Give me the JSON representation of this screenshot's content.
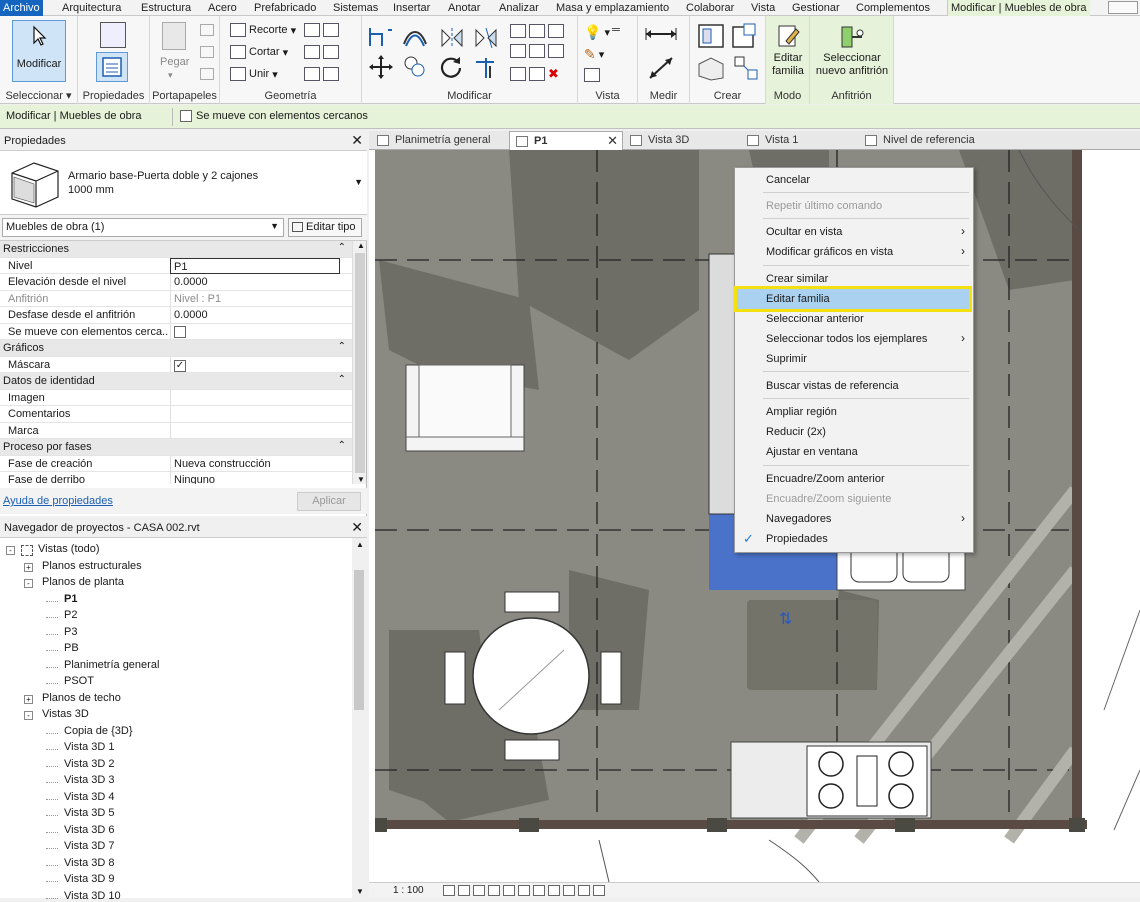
{
  "ribbon_tabs": [
    "Archivo",
    "Arquitectura",
    "Estructura",
    "Acero",
    "Prefabricado",
    "Sistemas",
    "Insertar",
    "Anotar",
    "Analizar",
    "Masa y emplazamiento",
    "Colaborar",
    "Vista",
    "Gestionar",
    "Complementos",
    "Modificar | Muebles de obra"
  ],
  "ribbon": {
    "modificar_label": "Modificar",
    "propiedades_label": "Propiedades",
    "pegar_label": "Pegar",
    "recorte_label": "Recorte",
    "cortar_label": "Cortar",
    "unir_label": "Unir",
    "editar_familia_line1": "Editar",
    "editar_familia_line2": "familia",
    "seleccionar_line1": "Seleccionar",
    "seleccionar_line2": "nuevo anfitrión",
    "panels": {
      "seleccionar": "Seleccionar",
      "propiedades": "Propiedades",
      "portapapeles": "Portapapeles",
      "geometria": "Geometría",
      "modificar": "Modificar",
      "vista": "Vista",
      "medir": "Medir",
      "crear": "Crear",
      "modo": "Modo",
      "anfitrion": "Anfitrión"
    }
  },
  "options_bar": {
    "context": "Modificar | Muebles de obra",
    "checkbox_label": "Se mueve con elementos cercanos"
  },
  "properties": {
    "title": "Propiedades",
    "type_name_line1": "Armario base-Puerta doble y 2 cajones",
    "type_name_line2": "1000 mm",
    "instance_filter": "Muebles de obra (1)",
    "edit_type": "Editar tipo",
    "rows": [
      {
        "group": true,
        "key": "Restricciones"
      },
      {
        "key": "Nivel",
        "value": "P1"
      },
      {
        "key": "Elevación desde el nivel",
        "value": "0.0000"
      },
      {
        "key": "Anfitrión",
        "value": "Nivel : P1",
        "dim": true
      },
      {
        "key": "Desfase desde el anfitrión",
        "value": "0.0000"
      },
      {
        "key": "Se mueve con elementos cerca...",
        "value": "",
        "checkbox": "unchecked"
      },
      {
        "group": true,
        "key": "Gráficos"
      },
      {
        "key": "Máscara",
        "value": "",
        "checkbox": "checked"
      },
      {
        "group": true,
        "key": "Datos de identidad"
      },
      {
        "key": "Imagen",
        "value": ""
      },
      {
        "key": "Comentarios",
        "value": ""
      },
      {
        "key": "Marca",
        "value": ""
      },
      {
        "group": true,
        "key": "Proceso por fases"
      },
      {
        "key": "Fase de creación",
        "value": "Nueva construcción"
      },
      {
        "key": "Fase de derribo",
        "value": "Ninguno"
      }
    ],
    "help_link": "Ayuda de propiedades",
    "apply": "Aplicar"
  },
  "browser": {
    "title": "Navegador de proyectos - CASA 002.rvt",
    "nodes": [
      {
        "label": "Vistas (todo)",
        "depth": 0,
        "toggle": "-"
      },
      {
        "label": "Planos estructurales",
        "depth": 1,
        "toggle": "+"
      },
      {
        "label": "Planos de planta",
        "depth": 1,
        "toggle": "-"
      },
      {
        "label": "P1",
        "depth": 2,
        "bold": true
      },
      {
        "label": "P2",
        "depth": 2
      },
      {
        "label": "P3",
        "depth": 2
      },
      {
        "label": "PB",
        "depth": 2
      },
      {
        "label": "Planimetría general",
        "depth": 2
      },
      {
        "label": "PSOT",
        "depth": 2
      },
      {
        "label": "Planos de techo",
        "depth": 1,
        "toggle": "+"
      },
      {
        "label": "Vistas 3D",
        "depth": 1,
        "toggle": "-"
      },
      {
        "label": "Copia de {3D}",
        "depth": 2
      },
      {
        "label": "Vista 3D 1",
        "depth": 2
      },
      {
        "label": "Vista 3D 2",
        "depth": 2
      },
      {
        "label": "Vista 3D 3",
        "depth": 2
      },
      {
        "label": "Vista 3D 4",
        "depth": 2
      },
      {
        "label": "Vista 3D 5",
        "depth": 2
      },
      {
        "label": "Vista 3D 6",
        "depth": 2
      },
      {
        "label": "Vista 3D 7",
        "depth": 2
      },
      {
        "label": "Vista 3D 8",
        "depth": 2
      },
      {
        "label": "Vista 3D 9",
        "depth": 2
      },
      {
        "label": "Vista 3D 10",
        "depth": 2
      }
    ]
  },
  "view_tabs": [
    {
      "label": "Planimetría general"
    },
    {
      "label": "P1",
      "active": true
    },
    {
      "label": "Vista 3D"
    },
    {
      "label": "Vista 1"
    },
    {
      "label": "Nivel de referencia"
    }
  ],
  "status": {
    "scale": "1 : 100"
  },
  "context_menu": [
    {
      "label": "Cancelar"
    },
    {
      "label": "Repetir último comando",
      "disabled": true
    },
    {
      "label": "Ocultar en vista",
      "submenu": true
    },
    {
      "label": "Modificar gráficos en vista",
      "submenu": true
    },
    {
      "label": "Crear similar"
    },
    {
      "label": "Editar familia",
      "highlighted": true
    },
    {
      "label": "Seleccionar anterior"
    },
    {
      "label": "Seleccionar todos los ejemplares",
      "submenu": true
    },
    {
      "label": "Suprimir"
    },
    {
      "label": "Buscar vistas de referencia"
    },
    {
      "label": "Ampliar región"
    },
    {
      "label": "Reducir (2x)"
    },
    {
      "label": "Ajustar en ventana"
    },
    {
      "label": "Encuadre/Zoom anterior"
    },
    {
      "label": "Encuadre/Zoom siguiente",
      "disabled": true
    },
    {
      "label": "Navegadores",
      "submenu": true
    },
    {
      "label": "Propiedades",
      "checked": true
    }
  ],
  "colors": {
    "file_tab": "#1565c0",
    "context_tab": "#e6f3d8",
    "menu_highlight": "#aad2f0",
    "highlight_outline": "#f4e00f",
    "floor": "#8a8a82",
    "selection": "#4a72c8"
  }
}
